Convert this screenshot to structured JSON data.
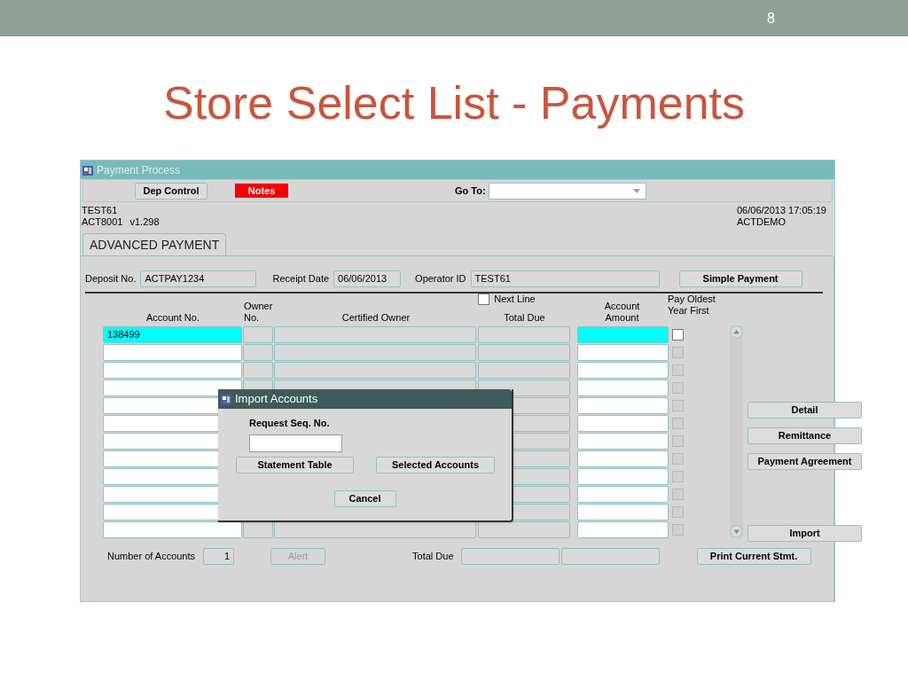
{
  "slide": {
    "number": "8",
    "title": "Store Select List - Payments"
  },
  "window": {
    "title": "Payment Process"
  },
  "toolbar": {
    "buttons": [
      {
        "label": "Dep Control",
        "kind": "normal"
      },
      {
        "label": "Notes",
        "kind": "alert"
      }
    ],
    "goto_label": "Go To:"
  },
  "header_info": {
    "user": "TEST61",
    "form": "ACT8001",
    "version": "v1.298",
    "datetime": "06/06/2013 17:05:19",
    "database": "ACTDEMO"
  },
  "tabs": [
    {
      "label": "ADVANCED PAYMENT",
      "selected": true
    }
  ],
  "fields": [
    {
      "label": "Deposit No.",
      "value": "ACTPAY1234"
    },
    {
      "label": "Receipt Date",
      "value": "06/06/2013"
    },
    {
      "label": "Operator ID",
      "value": "TEST61"
    }
  ],
  "simple_payment_button": "Simple Payment",
  "table": {
    "columns": [
      "Account No.",
      "Owner No.",
      "Certified Owner",
      "Total Due",
      "Account Amount",
      "Pay Oldest Year First"
    ],
    "next_line": {
      "label": "Next Line",
      "checked": false
    },
    "rows": [
      {
        "account_no": "138499",
        "selected": true,
        "checked": false,
        "disabled": false
      },
      {
        "selected": false,
        "checked": false,
        "disabled": true
      },
      {
        "selected": false,
        "checked": false,
        "disabled": true
      },
      {
        "selected": false,
        "checked": false,
        "disabled": true
      },
      {
        "selected": false,
        "checked": false,
        "disabled": true
      },
      {
        "selected": false,
        "checked": false,
        "disabled": true
      },
      {
        "selected": false,
        "checked": false,
        "disabled": true
      },
      {
        "selected": false,
        "checked": false,
        "disabled": true
      },
      {
        "selected": false,
        "checked": false,
        "disabled": true
      },
      {
        "selected": false,
        "checked": false,
        "disabled": true
      },
      {
        "selected": false,
        "checked": false,
        "disabled": true
      },
      {
        "selected": false,
        "checked": false,
        "disabled": true
      }
    ]
  },
  "side_buttons": [
    "Detail",
    "Remittance",
    "Payment Agreement",
    "Import"
  ],
  "footer": {
    "count_label": "Number of Accounts",
    "count": "1",
    "alert_button": {
      "label": "Alert",
      "disabled": true
    },
    "total_label": "Total Due",
    "print_button": "Print Current Stmt."
  },
  "dialog": {
    "title": "Import Accounts",
    "field_label": "Request Seq. No.",
    "buttons": [
      "Statement Table",
      "Selected Accounts"
    ],
    "cancel": "Cancel"
  }
}
